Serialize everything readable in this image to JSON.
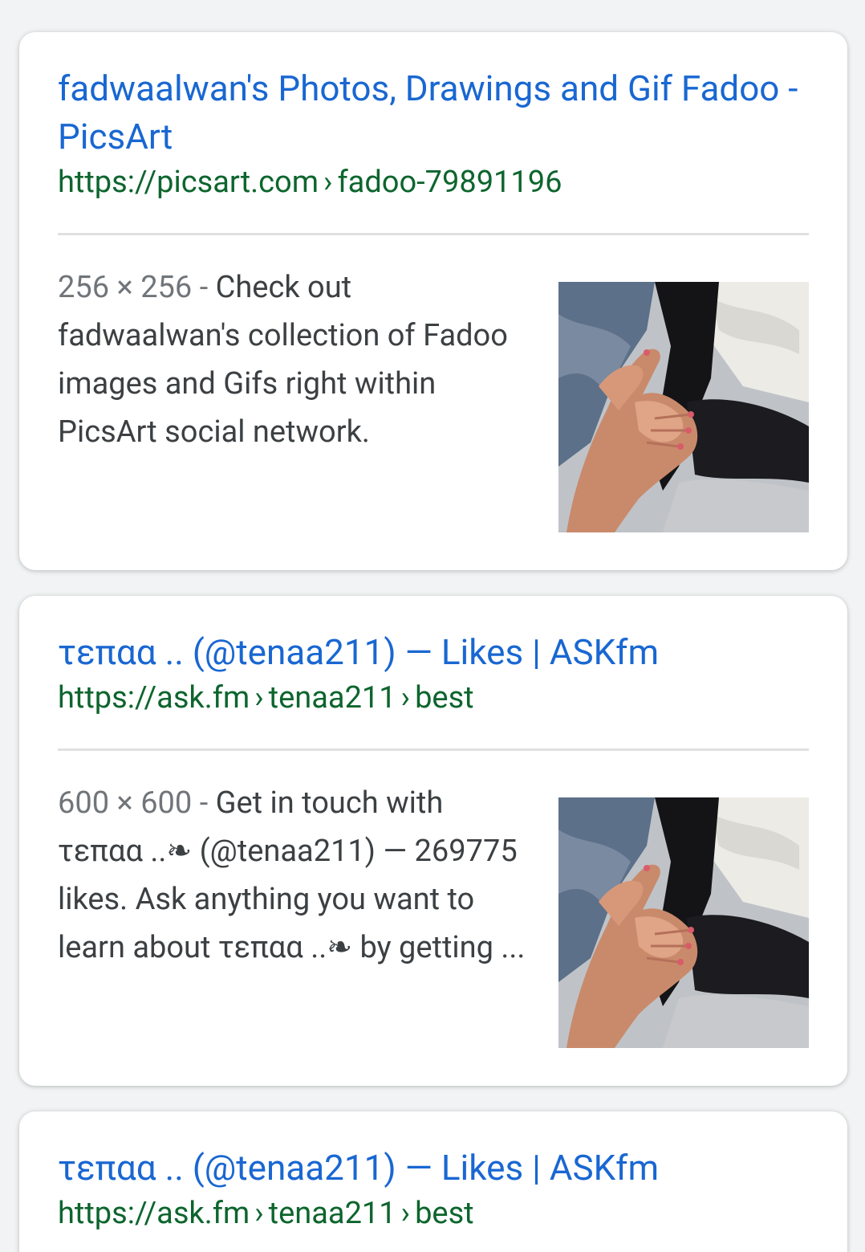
{
  "results": [
    {
      "title": "fadwaalwan's Photos, Drawings and Gif Fadoo - PicsArt",
      "url_domain": "https://picsart.com",
      "url_path": [
        "fadoo-79891196"
      ],
      "dimensions": "256 × 256",
      "dim_sep": " - ",
      "snippet": "Check out fadwaalwan's collection of Fadoo images and Gifs right within PicsArt social network.",
      "thumbnail_icon": "holding-hands-photo"
    },
    {
      "title": "τεπαα .. (@tenaa211) — Likes | ASKfm",
      "url_domain": "https://ask.fm",
      "url_path": [
        "tenaa211",
        "best"
      ],
      "dimensions": "600 × 600",
      "dim_sep": " - ",
      "snippet": "Get in touch with τεπαα ..❧ (@tenaa211) — 269775 likes. Ask anything you want to learn about τεπαα ..❧ by getting ...",
      "thumbnail_icon": "holding-hands-photo"
    },
    {
      "title": "τεπαα .. (@tenaa211) — Likes | ASKfm",
      "url_domain": "https://ask.fm",
      "url_path": [
        "tenaa211",
        "best"
      ]
    }
  ],
  "separator": "›",
  "colors": {
    "title": "#1967d2",
    "url": "#0d652d",
    "snippet": "#3c4043",
    "dims": "#70757a",
    "background": "#f1f3f4"
  }
}
